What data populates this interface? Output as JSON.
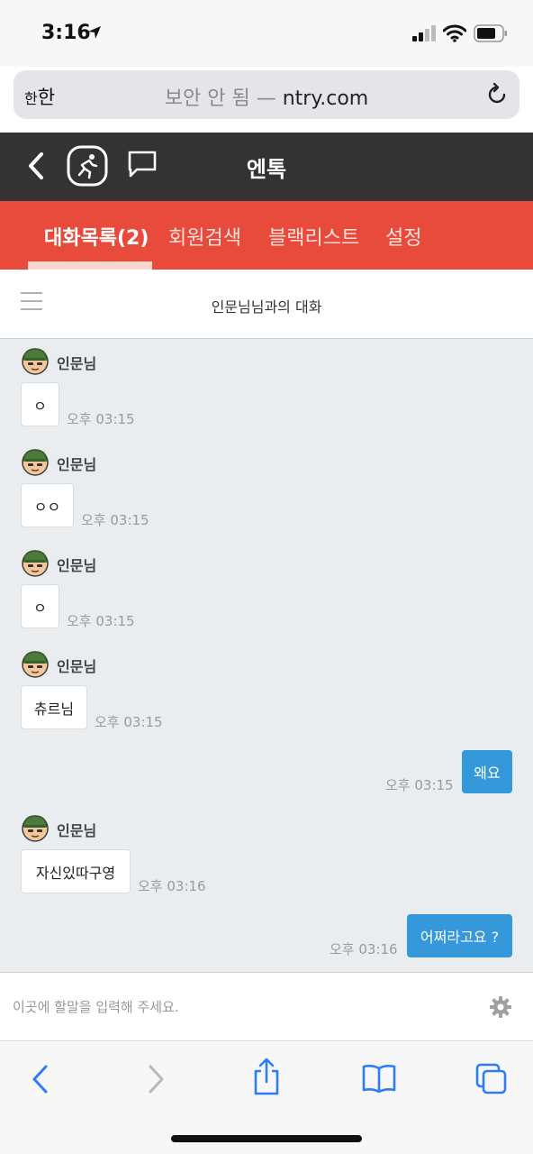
{
  "status": {
    "time": "3:16"
  },
  "browser": {
    "aa_label_small": "한",
    "aa_label": "한",
    "insecure_label": "보안 안 됨 —",
    "domain": "ntry.com"
  },
  "app": {
    "title": "엔톡"
  },
  "tabs": [
    {
      "label": "대화목록(2)",
      "active": true
    },
    {
      "label": "회원검색"
    },
    {
      "label": "블랙리스트"
    },
    {
      "label": "설정"
    }
  ],
  "conversation": {
    "title": "인문님님과의 대화"
  },
  "messages": [
    {
      "sender": "인문님",
      "text": "ㅇ",
      "time": "오후 03:15"
    },
    {
      "sender": "인문님",
      "text": "ㅇㅇ",
      "time": "오후 03:15"
    },
    {
      "sender": "인문님",
      "text": "ㅇ",
      "time": "오후 03:15"
    },
    {
      "sender": "인문님",
      "text": "츄르님",
      "time": "오후 03:15"
    },
    {
      "text": "왜요",
      "time": "오후 03:15"
    },
    {
      "sender": "인문님",
      "text": "자신있따구영",
      "time": "오후 03:16"
    },
    {
      "text": "어쩌라고요 ?",
      "time": "오후 03:16"
    }
  ],
  "input": {
    "placeholder": "이곳에 할말을 입력해 주세요."
  },
  "colors": {
    "header": "#333333",
    "tab_bar": "#e84b3c",
    "outgoing_bubble": "#3498db",
    "chat_bg": "#e9edf0"
  },
  "icons": [
    "location-arrow-icon",
    "signal-icon",
    "wifi-icon",
    "battery-icon",
    "reload-icon",
    "back-chevron-icon",
    "runner-logo-icon",
    "chat-bubble-icon",
    "hamburger-menu-icon",
    "avatar-icon",
    "gear-icon",
    "back-icon",
    "forward-icon",
    "share-icon",
    "bookmarks-icon",
    "tabs-icon"
  ]
}
